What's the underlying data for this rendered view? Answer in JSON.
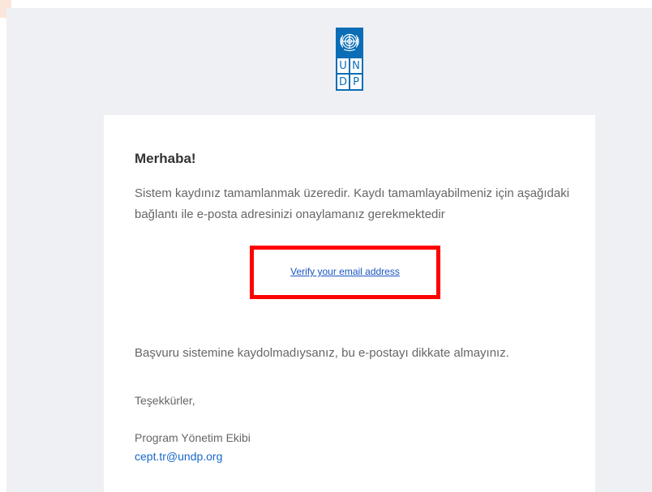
{
  "brand": {
    "logo_letters": [
      "U",
      "N",
      "D",
      "P"
    ],
    "logo_color": "#0a6db5",
    "emblem_icon": "un-emblem-icon"
  },
  "email": {
    "greeting": "Merhaba!",
    "intro": "Sistem kaydınız tamamlanmak üzeredir. Kaydı tamamlayabilmeniz için aşağıdaki bağlantı ile e-posta adresinizi onaylamanız gerekmektedir",
    "verify_link_label": "Verify your email address",
    "disclaimer": "Başvuru sistemine kaydolmadıysanız, bu e-postayı dikkate almayınız.",
    "thanks": "Teşekkürler,",
    "team_name": "Program Yönetim Ekibi",
    "contact_email": "cept.tr@undp.org"
  },
  "colors": {
    "highlight_box": "#ff0000",
    "link": "#1a55c0",
    "background": "#eff0f4"
  }
}
